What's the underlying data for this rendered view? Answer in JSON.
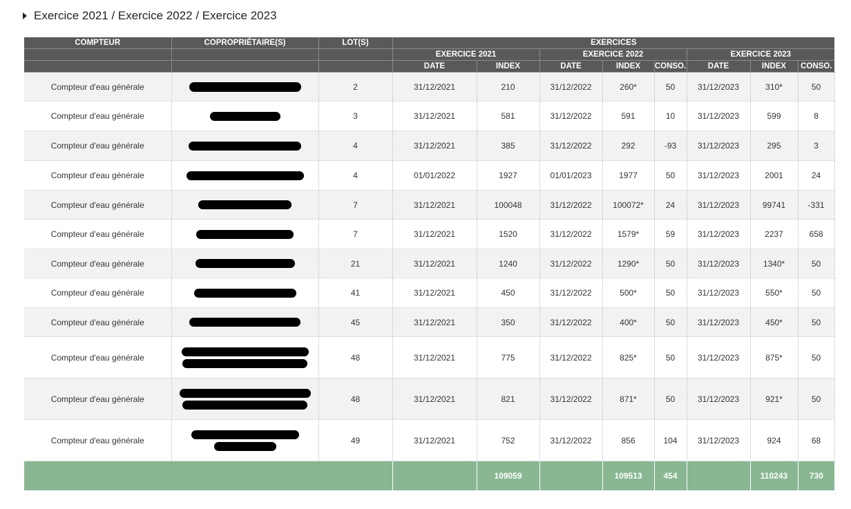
{
  "section": {
    "title": "Exercice 2021 / Exercice 2022 / Exercice 2023"
  },
  "headers": {
    "compteur": "COMPTEUR",
    "coproprietaires": "COPROPRIÉTAIRE(S)",
    "lots": "LOT(S)",
    "exercices": "EXERCICES",
    "y2021": "EXERCICE 2021",
    "y2022": "EXERCICE 2022",
    "y2023": "EXERCICE 2023",
    "date": "DATE",
    "index": "INDEX",
    "conso": "CONSO."
  },
  "rows": [
    {
      "compteur": "Compteur d'eau générale",
      "lot": "2",
      "d21": "31/12/2021",
      "i21": "210",
      "d22": "31/12/2022",
      "i22": "260*",
      "c22": "50",
      "d23": "31/12/2023",
      "i23": "310*",
      "c23": "50"
    },
    {
      "compteur": "Compteur d'eau générale",
      "lot": "3",
      "d21": "31/12/2021",
      "i21": "581",
      "d22": "31/12/2022",
      "i22": "591",
      "c22": "10",
      "d23": "31/12/2023",
      "i23": "599",
      "c23": "8"
    },
    {
      "compteur": "Compteur d'eau générale",
      "lot": "4",
      "d21": "31/12/2021",
      "i21": "385",
      "d22": "31/12/2022",
      "i22": "292",
      "c22": "-93",
      "d23": "31/12/2023",
      "i23": "295",
      "c23": "3"
    },
    {
      "compteur": "Compteur d'eau générale",
      "lot": "4",
      "d21": "01/01/2022",
      "i21": "1927",
      "d22": "01/01/2023",
      "i22": "1977",
      "c22": "50",
      "d23": "31/12/2023",
      "i23": "2001",
      "c23": "24"
    },
    {
      "compteur": "Compteur d'eau générale",
      "lot": "7",
      "d21": "31/12/2021",
      "i21": "100048",
      "d22": "31/12/2022",
      "i22": "100072*",
      "c22": "24",
      "d23": "31/12/2023",
      "i23": "99741",
      "c23": "-331"
    },
    {
      "compteur": "Compteur d'eau générale",
      "lot": "7",
      "d21": "31/12/2021",
      "i21": "1520",
      "d22": "31/12/2022",
      "i22": "1579*",
      "c22": "59",
      "d23": "31/12/2023",
      "i23": "2237",
      "c23": "658"
    },
    {
      "compteur": "Compteur d'eau générale",
      "lot": "21",
      "d21": "31/12/2021",
      "i21": "1240",
      "d22": "31/12/2022",
      "i22": "1290*",
      "c22": "50",
      "d23": "31/12/2023",
      "i23": "1340*",
      "c23": "50"
    },
    {
      "compteur": "Compteur d'eau générale",
      "lot": "41",
      "d21": "31/12/2021",
      "i21": "450",
      "d22": "31/12/2022",
      "i22": "500*",
      "c22": "50",
      "d23": "31/12/2023",
      "i23": "550*",
      "c23": "50"
    },
    {
      "compteur": "Compteur d'eau générale",
      "lot": "45",
      "d21": "31/12/2021",
      "i21": "350",
      "d22": "31/12/2022",
      "i22": "400*",
      "c22": "50",
      "d23": "31/12/2023",
      "i23": "450*",
      "c23": "50"
    },
    {
      "compteur": "Compteur d'eau générale",
      "lot": "48",
      "d21": "31/12/2021",
      "i21": "775",
      "d22": "31/12/2022",
      "i22": "825*",
      "c22": "50",
      "d23": "31/12/2023",
      "i23": "875*",
      "c23": "50"
    },
    {
      "compteur": "Compteur d'eau générale",
      "lot": "48",
      "d21": "31/12/2021",
      "i21": "821",
      "d22": "31/12/2022",
      "i22": "871*",
      "c22": "50",
      "d23": "31/12/2023",
      "i23": "921*",
      "c23": "50"
    },
    {
      "compteur": "Compteur d'eau générale",
      "lot": "49",
      "d21": "31/12/2021",
      "i21": "752",
      "d22": "31/12/2022",
      "i22": "856",
      "c22": "104",
      "d23": "31/12/2023",
      "i23": "924",
      "c23": "68"
    }
  ],
  "totals": {
    "i21": "109059",
    "i22": "109513",
    "c22": "454",
    "i23": "110243",
    "c23": "730"
  },
  "colors": {
    "header_bg": "#595959",
    "total_bg": "#89b792",
    "row_alt": "#f2f2f2"
  }
}
